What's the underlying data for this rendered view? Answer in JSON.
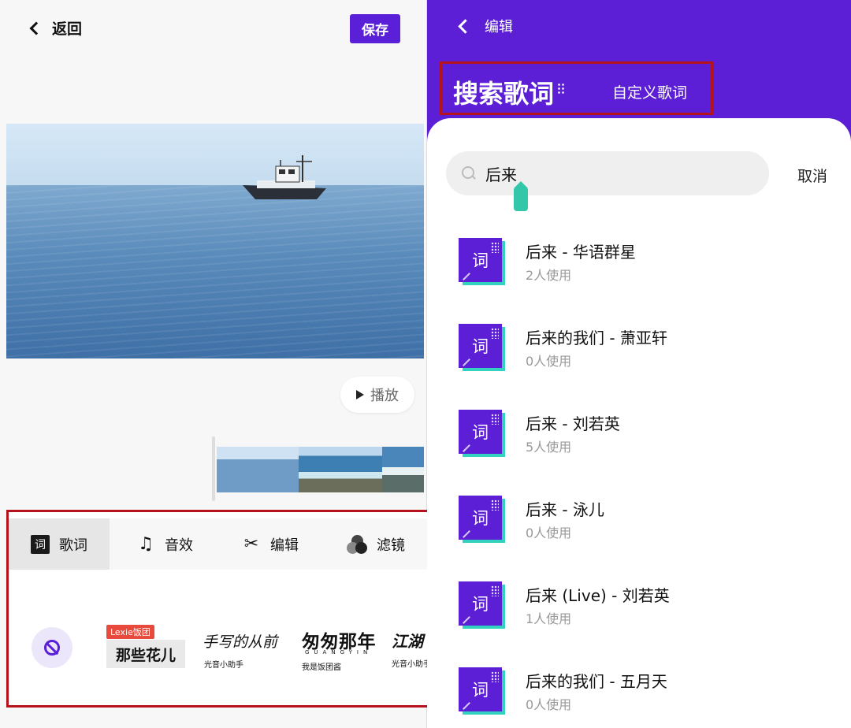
{
  "left": {
    "back_label": "返回",
    "save_label": "保存",
    "play_label": "播放",
    "tabs": [
      {
        "label": "歌词",
        "icon": "lyrics-icon",
        "icon_glyph": "词"
      },
      {
        "label": "音效",
        "icon": "music-note-icon",
        "icon_glyph": "♫"
      },
      {
        "label": "编辑",
        "icon": "scissors-icon",
        "icon_glyph": "✂"
      },
      {
        "label": "滤镜",
        "icon": "filter-circles-icon"
      }
    ],
    "styles": [
      {
        "tag": "Lexie饭团",
        "title": "那些花儿"
      },
      {
        "title": "手写的从前",
        "author": "光音小助手"
      },
      {
        "title": "匆匆那年",
        "small": "GUANGYIN",
        "author": "我是饭团酱"
      },
      {
        "title": "江湖",
        "author": "光音小助手"
      }
    ]
  },
  "right": {
    "back_label": "编辑",
    "search_lyrics_label": "搜索歌词",
    "custom_lyrics_label": "自定义歌词",
    "search_value": "后来",
    "cancel_label": "取消",
    "icon_glyph": "词",
    "results": [
      {
        "title": "后来 - 华语群星",
        "usage": "2人使用"
      },
      {
        "title": "后来的我们 - 萧亚轩",
        "usage": "0人使用"
      },
      {
        "title": "后来 - 刘若英",
        "usage": "5人使用"
      },
      {
        "title": "后来 - 泳儿",
        "usage": "0人使用"
      },
      {
        "title": "后来 (Live) - 刘若英",
        "usage": "1人使用"
      },
      {
        "title": "后来的我们 - 五月天",
        "usage": "0人使用"
      }
    ]
  },
  "colors": {
    "accent": "#5c1fd6",
    "highlight_border": "#b5121b",
    "cursor": "#31c7a8",
    "tag_red": "#e84b3d"
  }
}
